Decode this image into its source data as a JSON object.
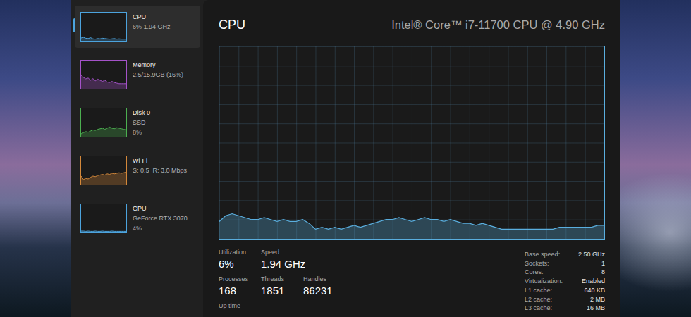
{
  "sidebar": {
    "items": [
      {
        "name": "CPU",
        "details": [
          "6% 1.94 GHz"
        ],
        "selected": true,
        "color": "#4ca3dd",
        "values": [
          10,
          12,
          9,
          8,
          11,
          7,
          6,
          8,
          7,
          9,
          8,
          7,
          6,
          7,
          8,
          6,
          7,
          6,
          6,
          6
        ]
      },
      {
        "name": "Memory",
        "details": [
          "2.5/15.9GB (16%)"
        ],
        "selected": false,
        "color": "#a452c8",
        "values": [
          48,
          40,
          35,
          38,
          30,
          36,
          28,
          34,
          30,
          26,
          30,
          24,
          22,
          26,
          22,
          20,
          18,
          18,
          18,
          18
        ]
      },
      {
        "name": "Disk 0",
        "details": [
          "SSD",
          "8%"
        ],
        "selected": false,
        "color": "#4caf50",
        "values": [
          10,
          14,
          18,
          16,
          20,
          24,
          22,
          26,
          28,
          30,
          26,
          30,
          34,
          30,
          28,
          32,
          30,
          28,
          26,
          24
        ]
      },
      {
        "name": "Wi-Fi",
        "details": [
          "S: 0.5  R: 3.0 Mbps"
        ],
        "selected": false,
        "color": "#d4883a",
        "values": [
          30,
          18,
          22,
          20,
          26,
          30,
          28,
          32,
          34,
          36,
          34,
          38,
          36,
          40,
          38,
          40,
          42,
          40,
          42,
          44
        ]
      },
      {
        "name": "GPU",
        "details": [
          "GeForce RTX 3070",
          "4%"
        ],
        "selected": false,
        "color": "#4ca3dd",
        "values": [
          5,
          5,
          4,
          5,
          4,
          4,
          5,
          4,
          4,
          5,
          4,
          4,
          4,
          5,
          4,
          4,
          4,
          4,
          4,
          4
        ]
      }
    ]
  },
  "main": {
    "title": "CPU",
    "subtitle": "Intel® Core™ i7-11700 CPU @ 4.90 GHz",
    "chart": {
      "values": [
        9,
        12,
        13,
        12,
        11,
        10,
        10,
        11,
        10,
        9,
        10,
        9,
        9,
        10,
        8,
        5,
        6,
        5,
        6,
        5,
        6,
        7,
        6,
        7,
        8,
        9,
        10,
        10,
        11,
        10,
        9,
        10,
        11,
        10,
        10,
        9,
        10,
        9,
        8,
        8,
        7,
        8,
        7,
        6,
        5,
        5,
        5,
        5,
        5,
        5,
        5,
        5,
        5,
        6,
        6,
        6,
        6,
        6,
        6,
        7,
        7
      ]
    },
    "stat_rows": [
      [
        {
          "label": "Utilization",
          "value": "6%"
        },
        {
          "label": "Speed",
          "value": "1.94 GHz"
        }
      ],
      [
        {
          "label": "Processes",
          "value": "168"
        },
        {
          "label": "Threads",
          "value": "1851"
        },
        {
          "label": "Handles",
          "value": "86231"
        }
      ],
      [
        {
          "label": "Up time"
        }
      ]
    ],
    "specs": [
      {
        "label": "Base speed:",
        "value": "2.50 GHz"
      },
      {
        "label": "Sockets:",
        "value": "1"
      },
      {
        "label": "Cores:",
        "value": "8"
      },
      {
        "label": "Virtualization:",
        "value": "Enabled"
      },
      {
        "label": "L1 cache:",
        "value": "640 KB"
      },
      {
        "label": "L2 cache:",
        "value": "2 MB"
      },
      {
        "label": "L3 cache:",
        "value": "16 MB"
      }
    ]
  }
}
